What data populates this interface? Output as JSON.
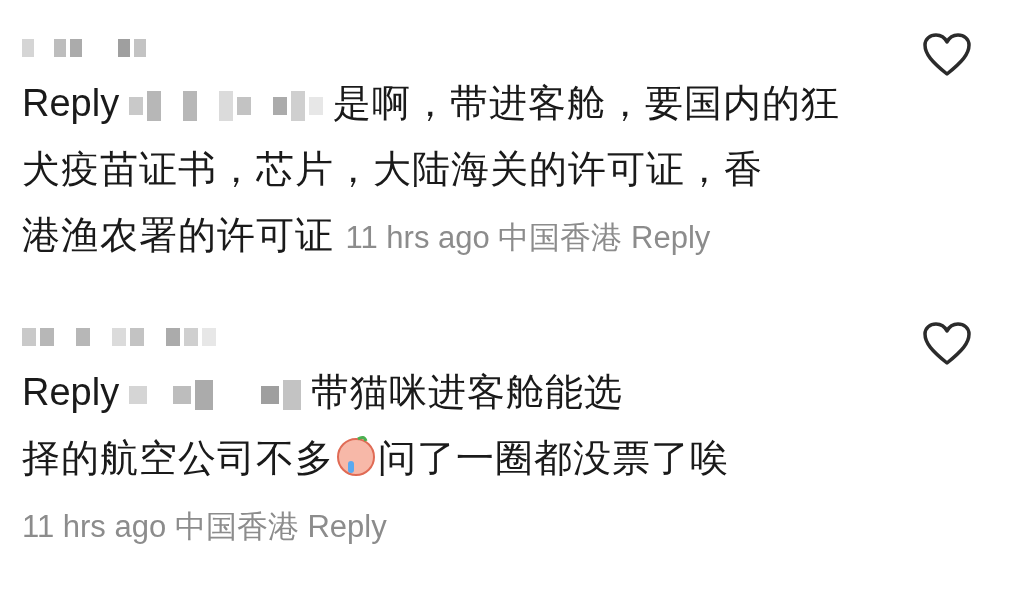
{
  "comments": [
    {
      "reply_label": "Reply",
      "segments": [
        {
          "kind": "text",
          "text": "是啊，带进客舱，要国内的狂"
        },
        {
          "kind": "line_break"
        },
        {
          "kind": "text",
          "text": "犬疫苗证书，芯片，大陆海关的许可证，香"
        },
        {
          "kind": "line_break"
        },
        {
          "kind": "text",
          "text": "港渔农署的许可证"
        }
      ],
      "time": "11 hrs ago",
      "location": "中国香港",
      "reply_link": "Reply",
      "liked": false
    },
    {
      "reply_label": "Reply",
      "segments": [
        {
          "kind": "text",
          "text": "带猫咪进客舱能选"
        },
        {
          "kind": "line_break"
        },
        {
          "kind": "text",
          "text": "择的航空公司不多"
        },
        {
          "kind": "emoji"
        },
        {
          "kind": "text",
          "text": "问了一圈都没票了唉"
        },
        {
          "kind": "line_break"
        }
      ],
      "time": "11 hrs ago",
      "location": "中国香港",
      "reply_link": "Reply",
      "liked": false
    }
  ]
}
